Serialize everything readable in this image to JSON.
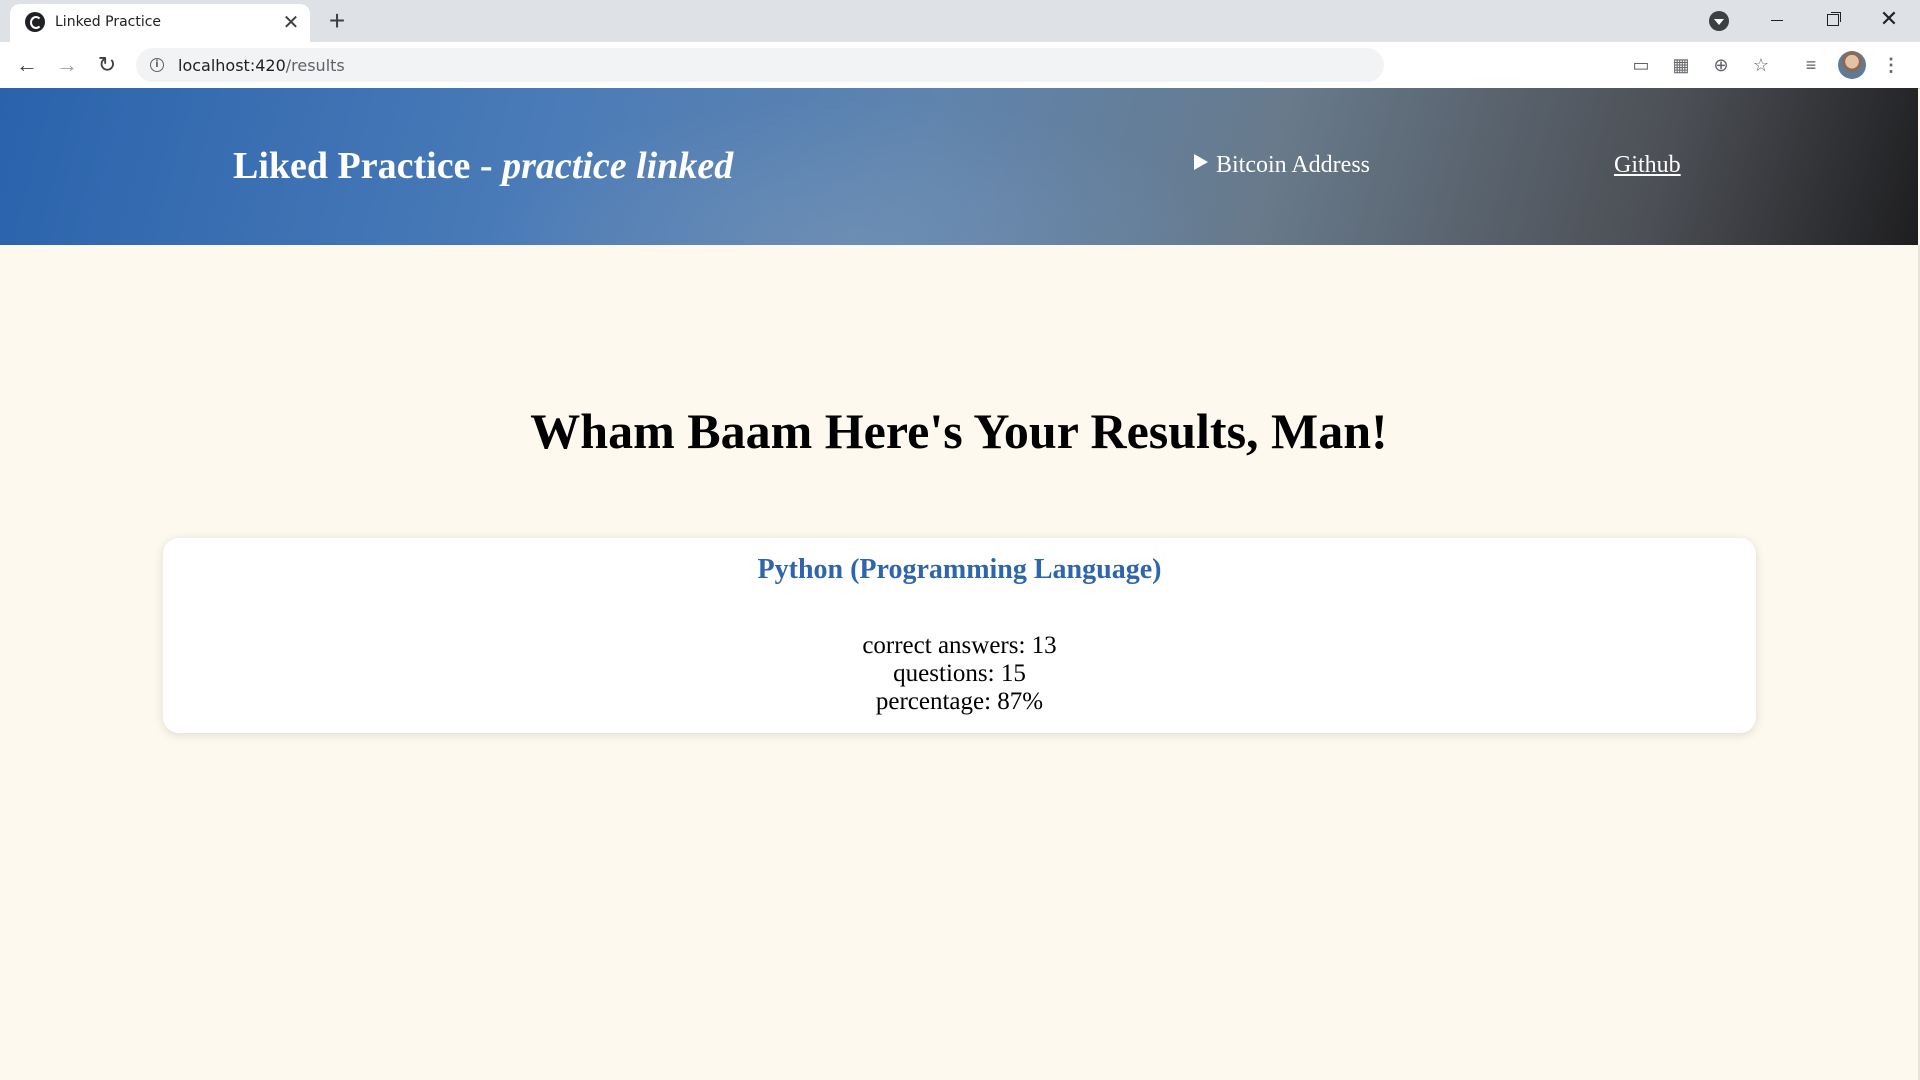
{
  "browser": {
    "tab_title": "Linked Practice",
    "url_host": "localhost:420",
    "url_path": "/results"
  },
  "header": {
    "title_plain": "Liked Practice - ",
    "title_italic": "practice linked",
    "bitcoin_label": "Bitcoin Address",
    "github_label": "Github"
  },
  "main": {
    "heading": "Wham Baam Here's Your Results, Man!",
    "result": {
      "subject": "Python (Programming Language)",
      "correct_label": "correct answers: 13",
      "questions_label": "questions: 15",
      "percentage_label": "percentage: 87%"
    }
  },
  "icons": {
    "favicon": "app-logo-icon",
    "back": "arrow-left-icon",
    "forward": "arrow-right-icon",
    "reload": "reload-icon",
    "info": "info-icon",
    "cast": "cast-icon",
    "qr": "qr-code-icon",
    "zoom": "zoom-icon",
    "star": "star-icon",
    "media": "media-control-icon",
    "menu": "kebab-menu-icon"
  },
  "colors": {
    "page_background": "#fdf9ee",
    "card_title": "#2f65ad"
  }
}
